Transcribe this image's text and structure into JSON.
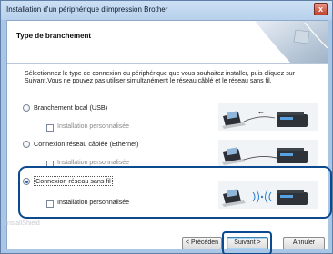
{
  "window": {
    "title": "Installation d'un périphérique d'impression Brother",
    "close_glyph": "x"
  },
  "banner": {
    "title": "Type de branchement"
  },
  "description": "Sélectionnez le type de connexion du périphérique que vous souhaitez installer, puis cliquez sur Suivant.Vous ne pouvez pas utiliser simultanément le réseau câblé et le réseau sans fil.",
  "options": [
    {
      "label": "Branchement local (USB)",
      "selected": false,
      "sub_label": "Installation personnalisée",
      "icon": "usb-connection-icon"
    },
    {
      "label": "Connexion réseau câblée (Ethernet)",
      "selected": false,
      "sub_label": "Installation personnalisée",
      "icon": "wired-network-icon"
    },
    {
      "label": "Connexion réseau sans fil",
      "selected": true,
      "sub_label": "Installation personnalisée",
      "icon": "wireless-network-icon"
    }
  ],
  "footer": {
    "faded_label": "InstallShield",
    "back_label": "< Précéden",
    "next_label": "Suivant >",
    "cancel_label": "Annuler"
  },
  "colors": {
    "highlight": "#0b4a8f",
    "titlebar": "#b7d0ec"
  }
}
